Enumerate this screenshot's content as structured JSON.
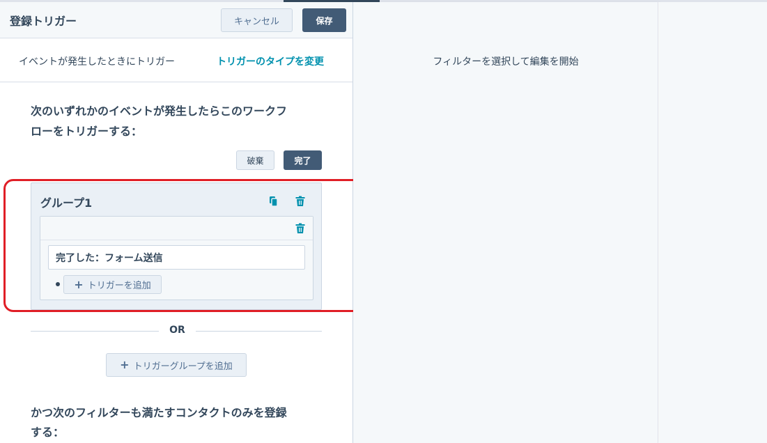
{
  "header": {
    "title": "登録トリガー",
    "cancel_label": "キャンセル",
    "save_label": "保存"
  },
  "subheader": {
    "text": "イベントが発生したときにトリガー",
    "link_label": "トリガーのタイプを変更"
  },
  "main": {
    "heading_line1": "次のいずれかのイベントが発生したらこのワークフ",
    "heading_line2": "ローをトリガーする：",
    "discard_label": "破棄",
    "done_label": "完了",
    "group": {
      "title": "グループ1",
      "filter_label": "完了した：フォーム送信",
      "add_trigger_label": "トリガーを追加"
    },
    "or_label": "OR",
    "add_group_label": "トリガーグループを追加",
    "filter_heading_line1": "かつ次のフィルターも満たすコンタクトのみを登録",
    "filter_heading_line2": "する："
  },
  "right_panel": {
    "placeholder_text": "フィルターを選択して編集を開始"
  },
  "colors": {
    "accent_teal": "#0091ae",
    "dark_button": "#425b76",
    "highlight_red": "#e01e26",
    "text": "#33475b"
  },
  "icons": [
    "copy-icon",
    "trash-icon",
    "plus-icon"
  ]
}
